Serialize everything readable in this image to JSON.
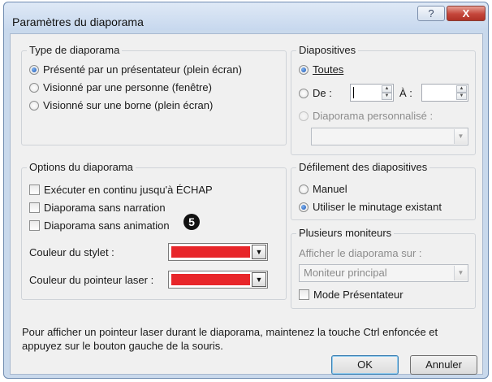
{
  "window": {
    "title": "Paramètres du diaporama",
    "help_icon": "?",
    "close_icon": "X"
  },
  "type_diaporama": {
    "legend": "Type de diaporama",
    "options": [
      {
        "label": "Présenté par un présentateur (plein écran)",
        "selected": true
      },
      {
        "label": "Visionné par une personne (fenêtre)",
        "selected": false
      },
      {
        "label": "Visionné sur une borne (plein écran)",
        "selected": false
      }
    ]
  },
  "diapositives": {
    "legend": "Diapositives",
    "toutes_label": "Toutes",
    "de_label": "De :",
    "a_label": "À :",
    "de_value": "",
    "a_value": "",
    "personnalise_label": "Diaporama personnalisé :",
    "personnalise_value": "",
    "selected": "toutes"
  },
  "options_diaporama": {
    "legend": "Options du diaporama",
    "checkboxes": [
      {
        "label": "Exécuter en continu jusqu'à ÉCHAP",
        "checked": false
      },
      {
        "label": "Diaporama sans narration",
        "checked": false
      },
      {
        "label": "Diaporama sans animation",
        "checked": false
      }
    ],
    "couleur_stylet_label": "Couleur du stylet :",
    "couleur_stylet_value": "#e8262a",
    "couleur_laser_label": "Couleur du pointeur laser :",
    "couleur_laser_value": "#e8262a"
  },
  "badge": "5",
  "defilement": {
    "legend": "Défilement des diapositives",
    "manuel_label": "Manuel",
    "minutage_label": "Utiliser le minutage existant",
    "selected": "minutage"
  },
  "moniteurs": {
    "legend": "Plusieurs moniteurs",
    "afficher_label": "Afficher le diaporama sur :",
    "moniteur_value": "Moniteur principal",
    "mode_presentateur_label": "Mode Présentateur",
    "mode_presentateur_checked": false
  },
  "footer_text": "Pour afficher un pointeur laser durant le diaporama, maintenez la touche Ctrl enfoncée et appuyez sur le bouton gauche de la souris.",
  "buttons": {
    "ok": "OK",
    "cancel": "Annuler"
  }
}
